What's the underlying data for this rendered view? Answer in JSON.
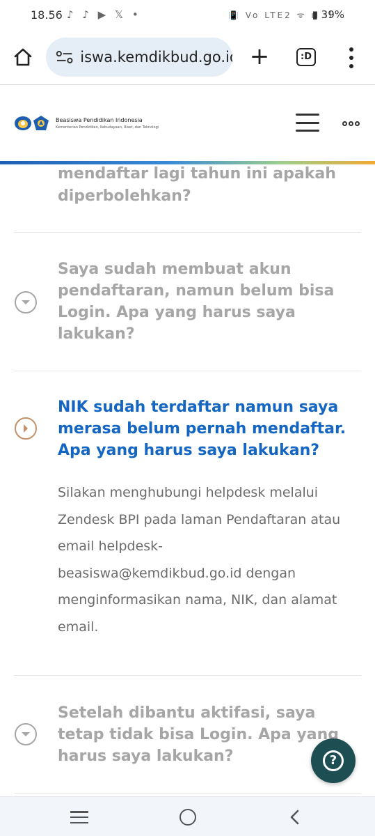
{
  "status_bar": {
    "time": "18.56",
    "app_icons": "♪ ♪ ▶ 𝕏 •",
    "system_icons": "📳 Vo LTE2 ᯤ ıl ıl",
    "battery": "▮ 39%"
  },
  "browser": {
    "url": "iswa.kemdikbud.go.id",
    "tab_label": ":D",
    "new_tab_symbol": "+"
  },
  "header": {
    "logo_title": "Beasiswa Pendidikan Indonesia",
    "logo_subtitle": "Kementerian Pendidikan, Kebudayaan, Riset, dan Teknologi"
  },
  "faq": {
    "partial_question": "mendaftar lagi tahun ini apakah diperbolehkan?",
    "items": [
      {
        "question": "Saya sudah membuat akun pendaftaran, namun belum bisa Login. Apa yang harus saya lakukan?",
        "expanded": false
      },
      {
        "question": "NIK sudah terdaftar namun saya merasa belum pernah mendaftar. Apa yang harus saya lakukan?",
        "answer": "Silakan menghubungi helpdesk melalui Zendesk BPI pada laman Pendaftaran atau email helpdesk-beasiswa@kemdikbud.go.id dengan menginformasikan nama, NIK, dan alamat email.",
        "expanded": true
      },
      {
        "question": "Setelah dibantu aktifasi, saya tetap tidak bisa Login. Apa yang harus saya lakukan?",
        "expanded": false
      }
    ]
  },
  "help_button": {
    "label": "?"
  },
  "colors": {
    "accent_blue": "#1466c2",
    "accent_orange": "#c4906a",
    "fab_teal": "#1d4e52",
    "collapsed_text": "#a6a6a6"
  }
}
